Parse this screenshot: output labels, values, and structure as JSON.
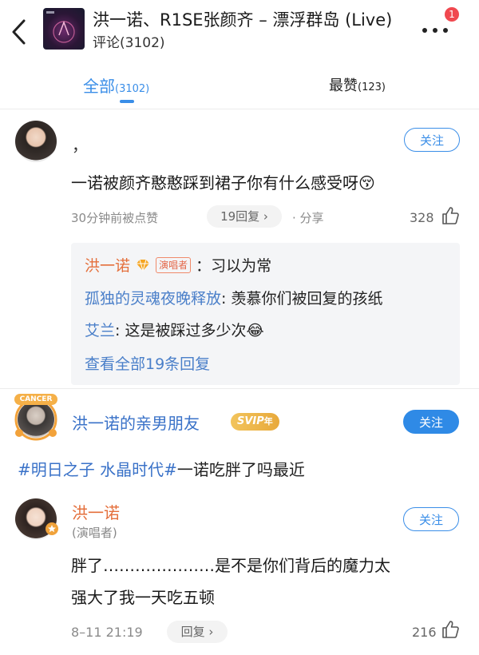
{
  "header": {
    "song_title": "洪一诺、R1SE张颜齐 – 漂浮群岛 (Live)",
    "comment_count": "评论(3102)",
    "badge": "1"
  },
  "tabs": {
    "all_label": "全部",
    "all_count": "(3102)",
    "hot_label": "最赞",
    "hot_count": "(123)"
  },
  "comments": [
    {
      "username": "，",
      "follow_label": "关注",
      "text": "一诺被颜齐憨憨踩到裙子你有什么感受呀",
      "emoji": "😚",
      "meta": "30分钟前被点赞",
      "replies_pill": "19回复 ›",
      "share_label": "· 分享",
      "like_count": "328",
      "replies": [
        {
          "name": "洪一诺",
          "tag": "演唱者",
          "text": "：习以为常"
        },
        {
          "name": "孤独的灵魂夜晚释放",
          "text": ": 羡慕你们被回复的孩纸"
        },
        {
          "name": "艾兰",
          "text": ": 这是被踩过多少次",
          "emoji": "😂"
        }
      ],
      "view_all_replies": "查看全部19条回复"
    },
    {
      "username": "洪一诺的亲男朋友",
      "badge": "SVIP",
      "badge_suffix": "年",
      "avatar_frame_text": "CANCER",
      "follow_label": "关注",
      "hashtag1": "#明日之子",
      "hashtag2": "水晶时代#",
      "text_rest": "一诺吃胖了吗最近"
    },
    {
      "username": "洪一诺",
      "role": "(演唱者)",
      "follow_label": "关注",
      "text_line1": "胖了…………………是不是你们背后的魔力太",
      "text_line2": "强大了我一天吃五顿",
      "meta": "8–11 21:19",
      "reply_pill": "回复 ›",
      "like_count": "216"
    }
  ]
}
